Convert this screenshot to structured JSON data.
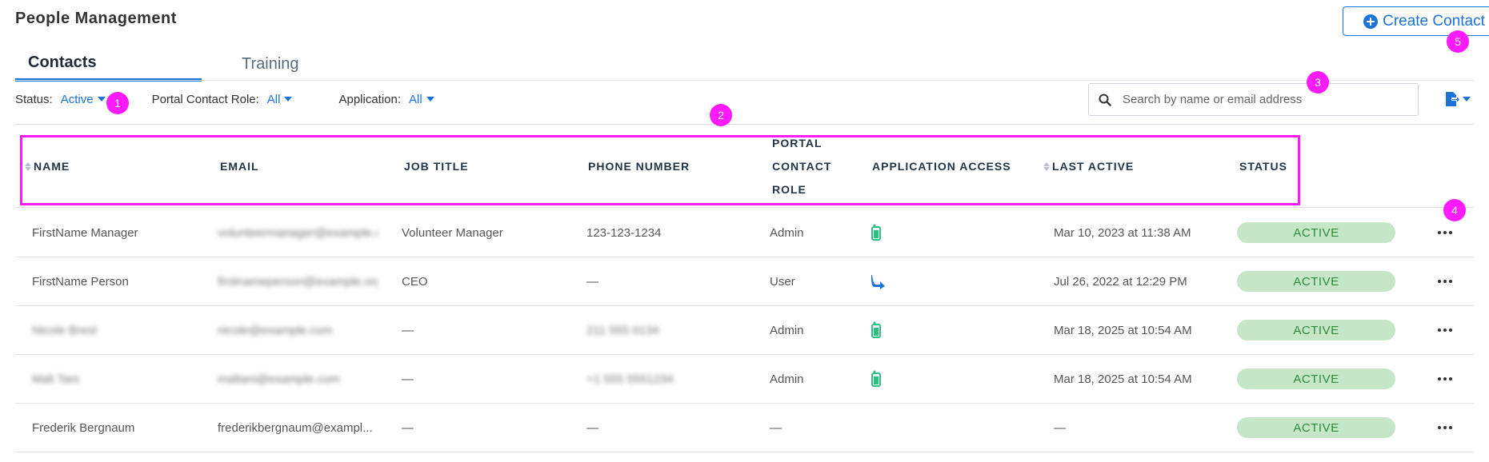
{
  "page_title": "People Management",
  "create_button": {
    "label": "Create Contact"
  },
  "tabs": [
    {
      "label": "Contacts",
      "active": true
    },
    {
      "label": "Training",
      "active": false
    }
  ],
  "filters": [
    {
      "label": "Status:",
      "value": "Active"
    },
    {
      "label": "Portal Contact Role:",
      "value": "All"
    },
    {
      "label": "Application:",
      "value": "All"
    }
  ],
  "search": {
    "placeholder": "Search by name or email address"
  },
  "table": {
    "columns": {
      "name": "NAME",
      "email": "EMAIL",
      "job_title": "JOB TITLE",
      "phone": "PHONE NUMBER",
      "role_line1": "PORTAL",
      "role_line2": "CONTACT",
      "role_line3": "ROLE",
      "app_access": "APPLICATION ACCESS",
      "last_active": "LAST ACTIVE",
      "status": "STATUS"
    },
    "rows": [
      {
        "name": "FirstName Manager",
        "email": "volunteermanager@example.org",
        "job_title": "Volunteer Manager",
        "phone": "123-123-1234",
        "role": "Admin",
        "app_icon": "volunteer-app-icon",
        "last_active": "Mar 10, 2023 at 11:38 AM",
        "status": "ACTIVE"
      },
      {
        "name": "FirstName Person",
        "email": "firstnameperson@example.org",
        "job_title": "CEO",
        "phone": "—",
        "role": "User",
        "app_icon": "blue-arrow-app-icon",
        "last_active": "Jul 26, 2022 at 12:29 PM",
        "status": "ACTIVE"
      },
      {
        "name": "Nicole Brest",
        "email": "nicole@example.com",
        "job_title": "—",
        "phone": "211 555 0134",
        "role": "Admin",
        "app_icon": "volunteer-app-icon",
        "last_active": "Mar 18, 2025 at 10:54 AM",
        "status": "ACTIVE"
      },
      {
        "name": "Mali Tani",
        "email": "maltani@example.com",
        "job_title": "—",
        "phone": "+1 555 5551234",
        "role": "Admin",
        "app_icon": "volunteer-app-icon",
        "last_active": "Mar 18, 2025 at 10:54 AM",
        "status": "ACTIVE"
      },
      {
        "name": "Frederik Bergnaum",
        "email": "frederikbergnaum@exampl...",
        "job_title": "—",
        "phone": "—",
        "role": "—",
        "app_icon": "",
        "last_active": "—",
        "status": "ACTIVE"
      }
    ]
  },
  "annotations": [
    "1",
    "2",
    "3",
    "4",
    "5"
  ],
  "colors": {
    "accent": "#1a73d9",
    "status_bg": "#c5e6c7",
    "status_text": "#2e8b3a",
    "annotation": "#ff1aff"
  }
}
